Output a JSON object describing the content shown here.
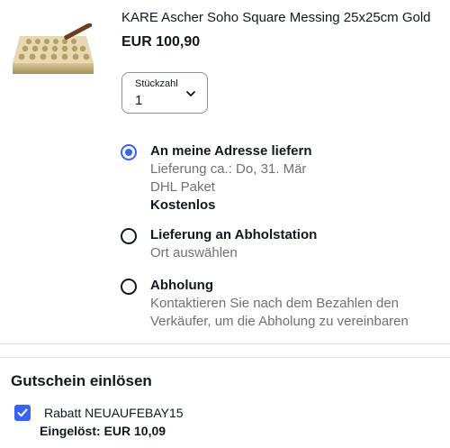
{
  "product": {
    "title": "KARE Ascher Soho Square Messing 25x25cm Gold",
    "price": "EUR 100,90",
    "image_icon": "brass-ashtray-image"
  },
  "quantity": {
    "label": "Stückzahl",
    "value": "1",
    "icon": "chevron-down-icon"
  },
  "delivery_options": [
    {
      "title": "An meine Adresse liefern",
      "selected": true,
      "lines": [
        "Lieferung ca.: Do, 31. Mär",
        "DHL Paket"
      ],
      "strong_line": "Kostenlos"
    },
    {
      "title": "Lieferung an Abholstation",
      "selected": false,
      "lines": [
        "Ort auswählen"
      ]
    },
    {
      "title": "Abholung",
      "selected": false,
      "lines": [
        "Kontaktieren Sie nach dem Bezahlen den",
        "Verkäufer, um die Abholung zu vereinbaren"
      ]
    }
  ],
  "coupon": {
    "section_title": "Gutschein einlösen",
    "checked": true,
    "name": "Rabatt NEUAUFEBAY15",
    "redeemed": "Eingelöst: EUR 10,09"
  },
  "colors": {
    "accent": "#3665f3",
    "text": "#111820",
    "secondary_text": "#707070"
  }
}
